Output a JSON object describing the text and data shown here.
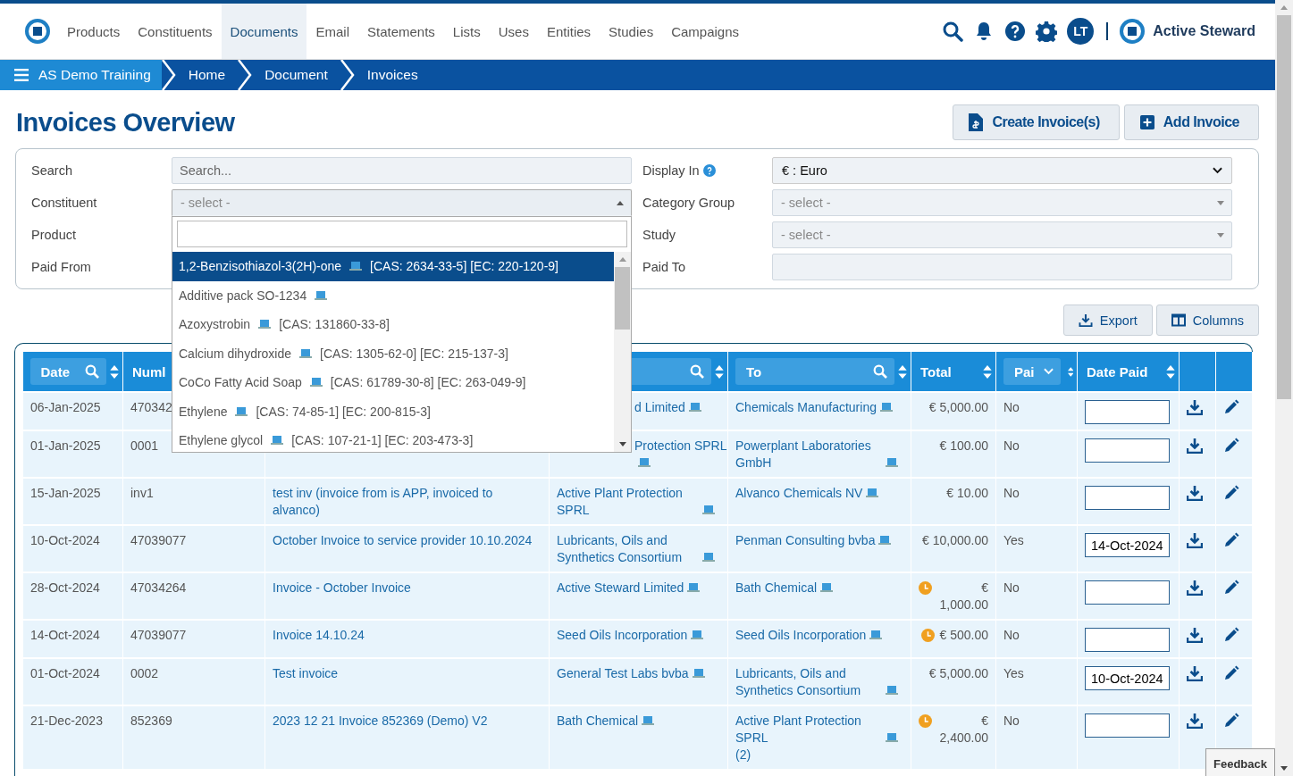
{
  "nav": {
    "items": [
      {
        "label": "Products",
        "selected": false
      },
      {
        "label": "Constituents",
        "selected": false
      },
      {
        "label": "Documents",
        "selected": true
      },
      {
        "label": "Email",
        "selected": false
      },
      {
        "label": "Statements",
        "selected": false
      },
      {
        "label": "Lists",
        "selected": false
      },
      {
        "label": "Uses",
        "selected": false
      },
      {
        "label": "Entities",
        "selected": false
      },
      {
        "label": "Studies",
        "selected": false
      },
      {
        "label": "Campaigns",
        "selected": false
      }
    ],
    "avatar": "LT",
    "brand": "Active Steward"
  },
  "breadcrumb": [
    "AS Demo Training",
    "Home",
    "Document",
    "Invoices"
  ],
  "page": {
    "title": "Invoices Overview",
    "buttons": [
      "Create Invoice(s)",
      "Add Invoice"
    ]
  },
  "filters": [
    {
      "label": "Search",
      "kind": "text",
      "placeholder": "Search..."
    },
    {
      "label": "Display In",
      "kind": "select",
      "value": "€ : Euro",
      "help": true
    },
    {
      "label": "Constituent",
      "kind": "combo",
      "placeholder": "- select -",
      "expanded": true
    },
    {
      "label": "Category Group",
      "kind": "combo",
      "placeholder": "- select -",
      "expanded": false
    },
    {
      "label": "Product",
      "kind": "hidden"
    },
    {
      "label": "Study",
      "kind": "combo",
      "placeholder": "- select -",
      "expanded": false
    },
    {
      "label": "Paid From",
      "kind": "hidden"
    },
    {
      "label": "Paid To",
      "kind": "text"
    }
  ],
  "dropdown": {
    "options": [
      {
        "name": "1,2-Benzisothiazol-3(2H)-one",
        "codes": "[CAS: 2634-33-5] [EC: 220-120-9]",
        "selected": true
      },
      {
        "name": "Additive pack SO-1234",
        "selected": false
      },
      {
        "name": "Azoxystrobin",
        "codes": "[CAS: 131860-33-8]",
        "selected": false
      },
      {
        "name": "Calcium dihydroxide",
        "codes": "[CAS: 1305-62-0] [EC: 215-137-3]",
        "selected": false
      },
      {
        "name": "CoCo Fatty Acid Soap",
        "codes": "[CAS: 61789-30-8] [EC: 263-049-9]",
        "selected": false
      },
      {
        "name": "Ethylene",
        "codes": "[CAS: 74-85-1] [EC: 200-815-3]",
        "selected": false
      },
      {
        "name": "Ethylene glycol",
        "codes": "[CAS: 107-21-1] [EC: 203-473-3]",
        "selected": false
      }
    ]
  },
  "toolbar": [
    "Export",
    "Columns"
  ],
  "table": {
    "columns": [
      {
        "label": "Date",
        "search": true,
        "sortable": true,
        "menu": false
      },
      {
        "label": "Numl"
      },
      {},
      {
        "search": true,
        "sortable": true,
        "menu": false
      },
      {
        "label": "To",
        "search": true,
        "sortable": true,
        "menu": false
      },
      {
        "label": "Total",
        "search": false,
        "sortable": true,
        "menu": false
      },
      {
        "label": "Pai",
        "search": false,
        "sortable": true,
        "menu": true
      },
      {
        "label": "Date Paid",
        "search": false,
        "sortable": true,
        "menu": false
      },
      {
        "search": false,
        "sortable": false,
        "menu": false
      },
      {
        "search": false,
        "sortable": false,
        "menu": false
      }
    ],
    "rows": [
      {
        "date": "06-Jan-2025",
        "number": "470342",
        "from": "d Limited",
        "to": "Chemicals Manufacturing",
        "total": "€ 5,000.00",
        "pending": false,
        "paid": "No"
      },
      {
        "date": "01-Jan-2025",
        "number": "0001",
        "from": "Protection SPRL",
        "to": "Powerplant Laboratories GmbH",
        "total": "€ 100.00",
        "pending": false,
        "paid": "No"
      },
      {
        "date": "15-Jan-2025",
        "number": "inv1",
        "description": "test inv (invoice from is APP, invoiced to alvanco)",
        "from": "Active Plant Protection SPRL",
        "to": "Alvanco Chemicals NV",
        "total": "€ 10.00",
        "pending": false,
        "paid": "No"
      },
      {
        "date": "10-Oct-2024",
        "number": "47039077",
        "description": "October Invoice to service provider 10.10.2024",
        "from": "Lubricants, Oils and Synthetics Consortium",
        "to": "Penman Consulting bvba",
        "total": "€ 10,000.00",
        "pending": false,
        "paid": "Yes",
        "date_paid": "14-Oct-2024"
      },
      {
        "date": "28-Oct-2024",
        "number": "47034264",
        "description": "Invoice - October Invoice",
        "from": "Active Steward Limited",
        "to": "Bath Chemical",
        "total": "€ 1,000.00",
        "pending": true,
        "paid": "No"
      },
      {
        "date": "14-Oct-2024",
        "number": "47039077",
        "description": "Invoice 14.10.24",
        "from": "Seed Oils Incorporation",
        "to": "Seed Oils Incorporation",
        "total": "€ 500.00",
        "pending": true,
        "paid": "No"
      },
      {
        "date": "01-Oct-2024",
        "number": "0002",
        "description": "Test invoice",
        "from": "General Test Labs bvba",
        "to": "Lubricants, Oils and Synthetics Consortium",
        "total": "€ 5,000.00",
        "pending": false,
        "paid": "Yes",
        "date_paid": "10-Oct-2024"
      },
      {
        "date": "21-Dec-2023",
        "number": "852369",
        "description": "2023 12 21 Invoice 852369 (Demo) V2",
        "from": "Bath Chemical",
        "to": "Active Plant Protection SPRL",
        "to_suffix": "(2)",
        "total": "€ 2,400.00",
        "pending": true,
        "paid": "No"
      }
    ]
  },
  "feedback": "Feedback"
}
